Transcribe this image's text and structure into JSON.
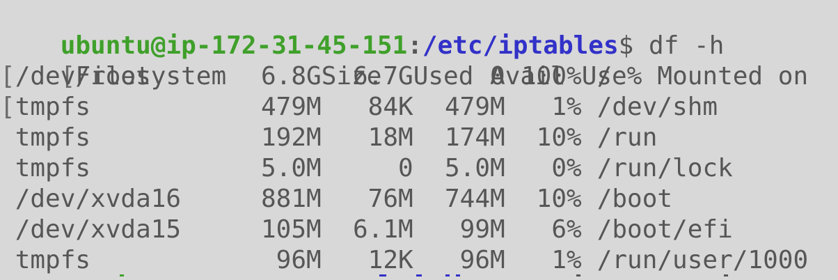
{
  "prompt": {
    "user_host": "ubuntu@ip-172-31-45-151",
    "colon": ":",
    "path": "/etc/iptables",
    "dollar": "$",
    "command": " df -h"
  },
  "header": {
    "filesystem": "Filesystem",
    "size": "Size",
    "used": "Used",
    "avail": "Avail",
    "use": "Use%",
    "mounted": "Mounted on"
  },
  "rows": [
    {
      "gutter": "[",
      "filesystem": "/dev/root",
      "size": "6.8G",
      "used": "6.7G",
      "avail": "0",
      "use": "100%",
      "mounted": "/"
    },
    {
      "gutter": "[",
      "filesystem": "tmpfs",
      "size": "479M",
      "used": "84K",
      "avail": "479M",
      "use": "1%",
      "mounted": "/dev/shm"
    },
    {
      "gutter": " ",
      "filesystem": "tmpfs",
      "size": "192M",
      "used": "18M",
      "avail": "174M",
      "use": "10%",
      "mounted": "/run"
    },
    {
      "gutter": " ",
      "filesystem": "tmpfs",
      "size": "5.0M",
      "used": "0",
      "avail": "5.0M",
      "use": "0%",
      "mounted": "/run/lock"
    },
    {
      "gutter": " ",
      "filesystem": "/dev/xvda16",
      "size": "881M",
      "used": "76M",
      "avail": "744M",
      "use": "10%",
      "mounted": "/boot"
    },
    {
      "gutter": " ",
      "filesystem": "/dev/xvda15",
      "size": "105M",
      "used": "6.1M",
      "avail": "99M",
      "use": "6%",
      "mounted": "/boot/efi"
    },
    {
      "gutter": " ",
      "filesystem": "tmpfs",
      "size": "96M",
      "used": "12K",
      "avail": "96M",
      "use": "1%",
      "mounted": "/run/user/1000"
    }
  ],
  "header_gutter": "[",
  "colors": {
    "background": "#d8d8d8",
    "text": "#565656",
    "prompt_user": "#3fa02a",
    "prompt_path": "#3231c8"
  }
}
